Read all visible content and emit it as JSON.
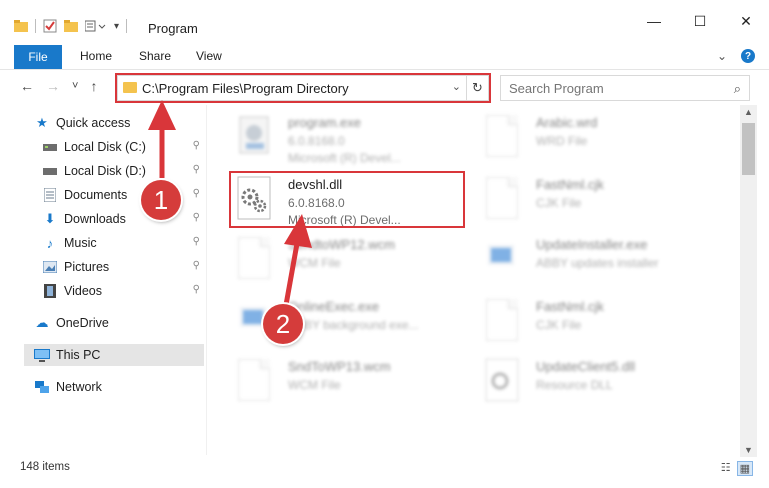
{
  "window": {
    "title": "Program",
    "controls": {
      "minimize": "—",
      "maximize": "☐",
      "close": "✕"
    }
  },
  "ribbon": {
    "tabs": [
      "File",
      "Home",
      "Share",
      "View"
    ],
    "expand_glyph": "⌄",
    "help_glyph": "?"
  },
  "navigation": {
    "back": "←",
    "forward": "→",
    "recent": "˅",
    "up": "↑",
    "address": "C:\\Program Files\\Program Directory",
    "address_dropdown": "⌄",
    "refresh": "↻",
    "search_placeholder": "Search Program"
  },
  "sidebar": {
    "items": [
      {
        "label": "Quick access",
        "icon": "star-icon",
        "glyph": "★",
        "color": "#1979ca",
        "pinned": false
      },
      {
        "label": "Local Disk (C:)",
        "icon": "drive-icon",
        "glyph": "▬",
        "color": "#555555",
        "pinned": true
      },
      {
        "label": "Local Disk (D:)",
        "icon": "drive-icon",
        "glyph": "▬",
        "color": "#555555",
        "pinned": true
      },
      {
        "label": "Documents",
        "icon": "documents-icon",
        "glyph": "▤",
        "color": "#6b7d8f",
        "pinned": true
      },
      {
        "label": "Downloads",
        "icon": "download-icon",
        "glyph": "⬇",
        "color": "#1979ca",
        "pinned": true
      },
      {
        "label": "Music",
        "icon": "music-icon",
        "glyph": "♪",
        "color": "#1979ca",
        "pinned": true
      },
      {
        "label": "Pictures",
        "icon": "pictures-icon",
        "glyph": "▣",
        "color": "#4a7fb5",
        "pinned": true
      },
      {
        "label": "Videos",
        "icon": "videos-icon",
        "glyph": "▦",
        "color": "#444444",
        "pinned": true
      },
      {
        "label": "OneDrive",
        "icon": "cloud-icon",
        "glyph": "☁",
        "color": "#1979ca",
        "pinned": false
      },
      {
        "label": "This PC",
        "icon": "computer-icon",
        "glyph": "▭",
        "color": "#1979ca",
        "pinned": false
      },
      {
        "label": "Network",
        "icon": "network-icon",
        "glyph": "⊞",
        "color": "#1979ca",
        "pinned": false
      }
    ],
    "pin_glyph": "📌"
  },
  "files": [
    {
      "name": "program.exe",
      "line2": "6.0.8168.0",
      "line3": "Microsoft (R) Devel...",
      "icon": "exe-icon",
      "blurred": true
    },
    {
      "name": "Arabic.wrd",
      "line2": "WRD File",
      "line3": "",
      "icon": "file-icon",
      "blurred": true
    },
    {
      "name": "devshl.dll",
      "line2": "6.0.8168.0",
      "line3": "Microsoft (R) Devel...",
      "icon": "dll-gear-icon",
      "blurred": false
    },
    {
      "name": "FastNml.cjk",
      "line2": "CJK File",
      "line3": "",
      "icon": "file-icon",
      "blurred": true
    },
    {
      "name": "SendtoWP12.wcm",
      "line2": "WCM File",
      "line3": "",
      "icon": "file-icon",
      "blurred": true
    },
    {
      "name": "UpdateInstaller.exe",
      "line2": "ABBY updates installer",
      "line3": "",
      "icon": "exe-window-icon",
      "blurred": true
    },
    {
      "name": "OnlineExec.exe",
      "line2": "ABBY background exe...",
      "line3": "",
      "icon": "exe-window-icon",
      "blurred": true
    },
    {
      "name": "FastNml.cjk",
      "line2": "CJK File",
      "line3": "",
      "icon": "file-icon",
      "blurred": true
    },
    {
      "name": "SndToWP13.wcm",
      "line2": "WCM File",
      "line3": "",
      "icon": "file-icon",
      "blurred": true
    },
    {
      "name": "UpdateClient5.dll",
      "line2": "Resource DLL",
      "line3": "",
      "icon": "dll-gear-icon",
      "blurred": true
    }
  ],
  "status": {
    "item_count": "148 items"
  },
  "annotations": [
    {
      "number": "1",
      "color": "#d53c3b"
    },
    {
      "number": "2",
      "color": "#d53c3b"
    }
  ]
}
